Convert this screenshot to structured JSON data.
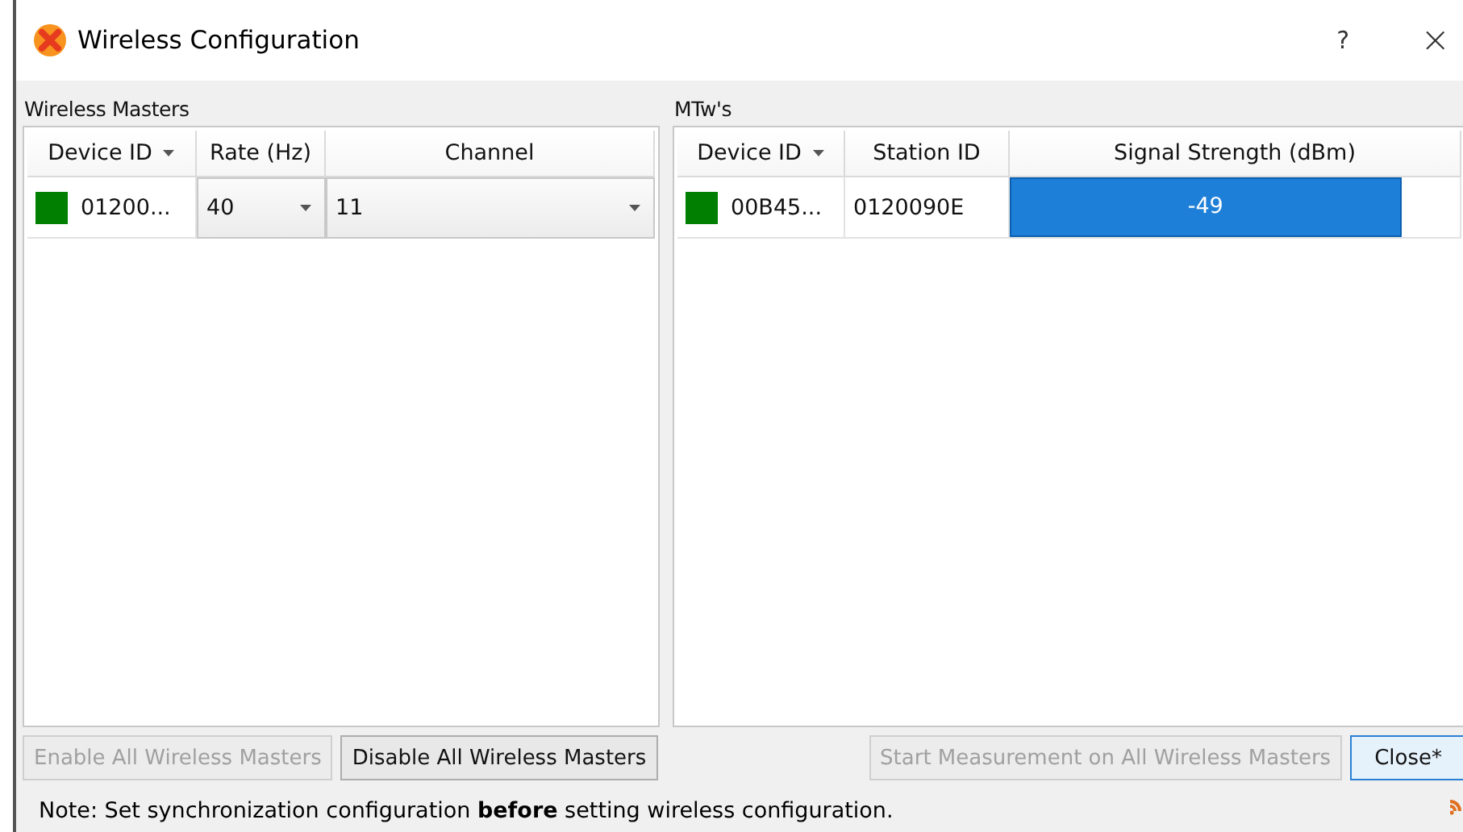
{
  "window": {
    "title": "Wireless Configuration",
    "help": "?",
    "close": "×"
  },
  "masters": {
    "title": "Wireless Masters",
    "columns": [
      {
        "label": "Device ID",
        "sortable": true
      },
      {
        "label": "Rate (Hz)",
        "sortable": false
      },
      {
        "label": "Channel",
        "sortable": false
      }
    ],
    "rows": [
      {
        "color": "#007f00",
        "device_id": "01200...",
        "rate": "40",
        "channel": "11"
      }
    ],
    "buttons": [
      {
        "label": "Enable All Wireless Masters",
        "disabled": true,
        "default": false
      },
      {
        "label": "Disable All Wireless Masters",
        "disabled": false,
        "default": false
      }
    ]
  },
  "mtws": {
    "title": "MTw's",
    "columns": [
      {
        "label": "Device ID",
        "sortable": true
      },
      {
        "label": "Station ID",
        "sortable": false
      },
      {
        "label": "Signal Strength (dBm)",
        "sortable": false
      }
    ],
    "rows": [
      {
        "color": "#007f00",
        "device_id": "00B45...",
        "station_id": "0120090E",
        "level": 0.87,
        "reading": "-49"
      }
    ],
    "buttons": [
      {
        "label": "Start Measurement on All Wireless Masters",
        "disabled": true,
        "default": false
      },
      {
        "label": "Close*",
        "disabled": false,
        "default": true
      }
    ]
  },
  "note": "Note: Set synchronization configuration **before** setting wireless configuration."
}
